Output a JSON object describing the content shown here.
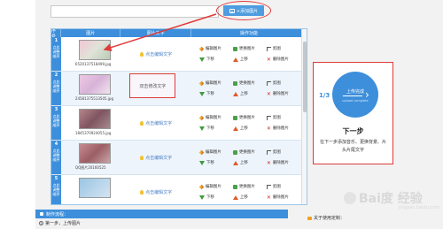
{
  "toolbar": {
    "add_image_label": "+添加图片",
    "search_value": ""
  },
  "grid": {
    "headers": {
      "no": "序号",
      "image": "图片",
      "text": "图片文字",
      "ops": "操作功能"
    },
    "op_labels": {
      "edit_image": "编辑图片",
      "replace_image": "更换图片",
      "crop": "剪图",
      "move_down": "下移",
      "move_up": "上移",
      "delete_image": "删除图片"
    },
    "order_label_lines": [
      "点此",
      "调整",
      "顺序"
    ],
    "rows": [
      {
        "num": "1",
        "caption": "6520137518499.jpg",
        "text": "点击编辑文字",
        "text_highlighted": false
      },
      {
        "num": "2",
        "caption": "24581375513505.jpg",
        "text": "双击修改文字",
        "text_highlighted": true
      },
      {
        "num": "3",
        "caption": "1845370924055.jpg",
        "text": "点击编辑文字",
        "text_highlighted": false
      },
      {
        "num": "4",
        "caption": "QQ图片20160525",
        "text": "点击编辑文字",
        "text_highlighted": false
      },
      {
        "num": "5",
        "caption": "",
        "text": "点击编辑文字",
        "text_highlighted": false
      }
    ]
  },
  "side_panel": {
    "circle_label": "上传完成",
    "circle_sub": "upload complete",
    "step_count": "1/3",
    "next_title": "下一步",
    "next_desc": "在下一步添加音乐、更换背景、片头片尾文字"
  },
  "bottom": {
    "bar_label": "制作流程：",
    "step_num": "1",
    "step_text": "第一步，上传图片",
    "help_text": "关于使用定制：",
    "watermark": "Bai度 经验",
    "watermark_sub": "jingyan.baidu.com"
  },
  "colors": {
    "accent": "#3d8fdc",
    "highlight": "#e03a3a"
  }
}
